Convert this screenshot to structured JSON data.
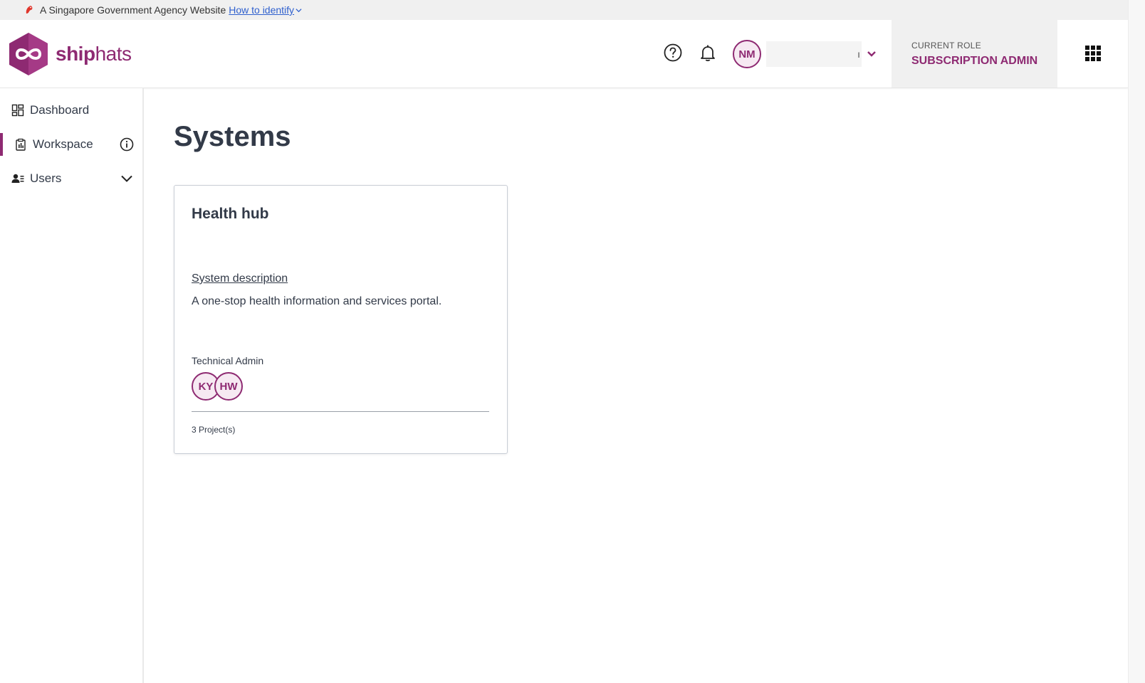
{
  "masthead": {
    "text": "A Singapore Government Agency Website",
    "link": "How to identify"
  },
  "header": {
    "logo_text_bold": "ship",
    "logo_text_rest": "hats",
    "user_initials": "NM",
    "user_name_visible": "ı",
    "role_label": "CURRENT ROLE",
    "role_value": "SUBSCRIPTION ADMIN"
  },
  "sidebar": {
    "items": [
      {
        "label": "Dashboard"
      },
      {
        "label": "Workspace"
      },
      {
        "label": "Users"
      }
    ]
  },
  "main": {
    "title": "Systems",
    "card": {
      "title": "Health hub",
      "desc_link": "System description",
      "description": "A one-stop health information and services portal.",
      "admin_label": "Technical Admin",
      "admins": [
        "KY",
        "HW"
      ],
      "footer": "3 Project(s)"
    }
  },
  "colors": {
    "brand": "#8e2a72",
    "link": "#2f60ce",
    "text": "#323a48"
  }
}
